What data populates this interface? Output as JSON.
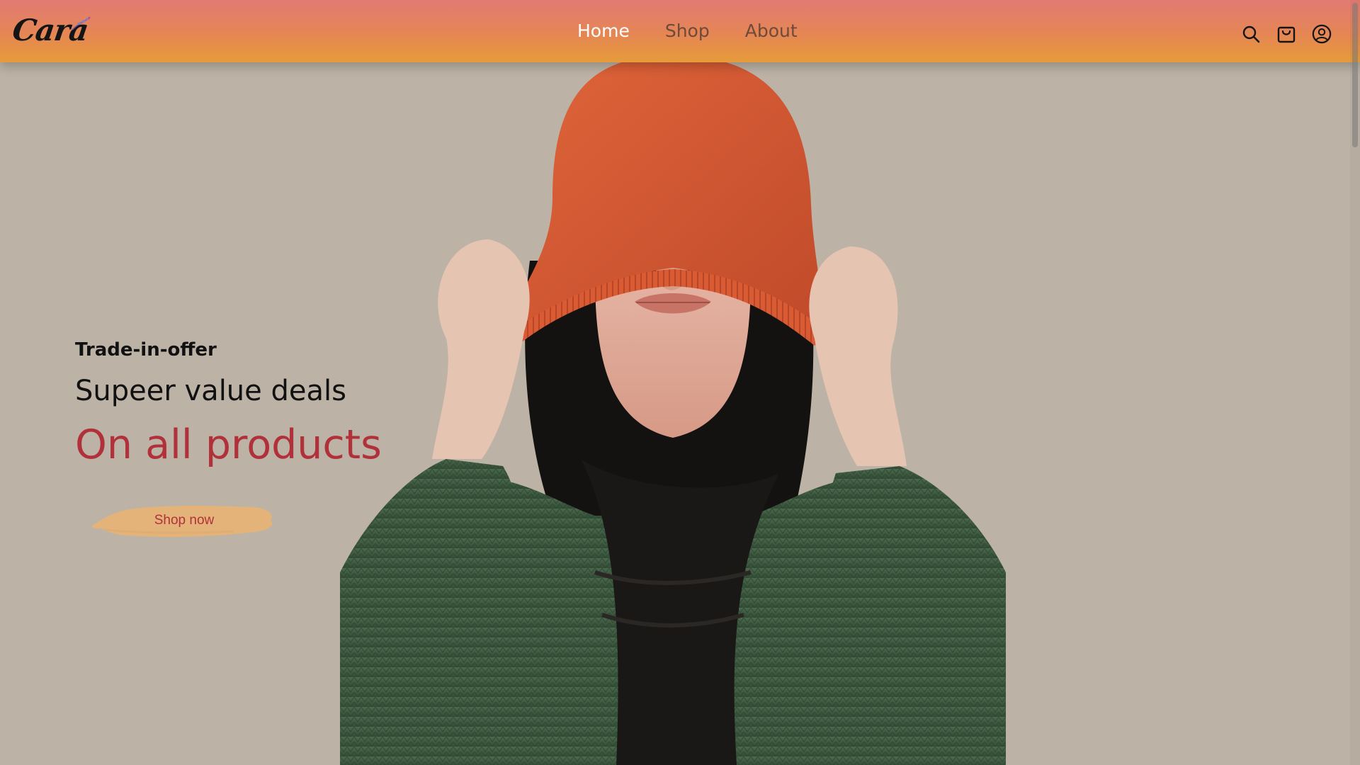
{
  "brand": {
    "logo_text": "Cara"
  },
  "nav": {
    "items": [
      {
        "label": "Home",
        "active": true
      },
      {
        "label": "Shop",
        "active": false
      },
      {
        "label": "About",
        "active": false
      }
    ]
  },
  "header_icons": [
    "search-icon",
    "cart-icon",
    "user-icon"
  ],
  "hero": {
    "eyebrow": "Trade-in-offer",
    "headline": "Supeer value deals",
    "highlight": "On all products",
    "cta_label": "Shop now"
  },
  "colors": {
    "header_gradient_top": "#e27b74",
    "header_gradient_bottom": "#e69b3a",
    "hero_background": "#bcb2a6",
    "accent_red": "#b1313a",
    "cta_brush": "#e4b37a",
    "nav_active": "#ffffff"
  }
}
